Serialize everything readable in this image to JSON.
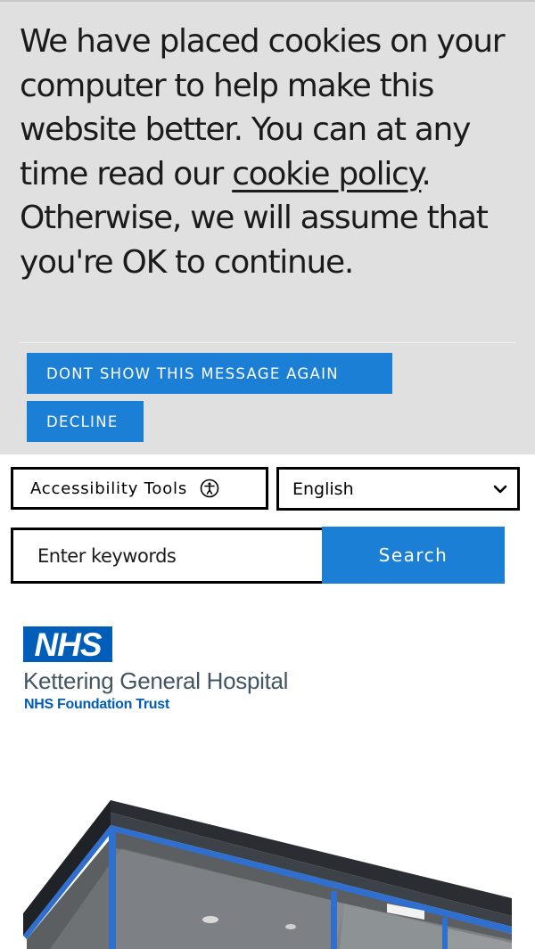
{
  "cookie_banner": {
    "text_before": "We have placed cookies on your computer to help make this website better. You can at any time read our ",
    "link_text": "cookie policy",
    "text_after": ". Otherwise, we will assume that you're OK to continue.",
    "dont_show_label": "DONT SHOW THIS MESSAGE AGAIN",
    "decline_label": "DECLINE"
  },
  "tools": {
    "accessibility_label": "Accessibility Tools",
    "accessibility_icon": "accessibility-icon",
    "language_value": "English",
    "language_icon": "chevron-down-icon"
  },
  "search": {
    "placeholder": "Enter keywords",
    "button_label": "Search"
  },
  "logo": {
    "mark": "NHS",
    "org_name": "Kettering General Hospital",
    "org_subtitle": "NHS Foundation Trust"
  },
  "colors": {
    "banner_bg": "#e0e0e0",
    "accent_blue": "#1c7fd6",
    "nhs_blue": "#005eb8",
    "nhs_grey": "#425563"
  }
}
